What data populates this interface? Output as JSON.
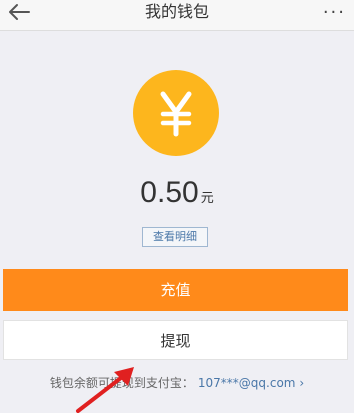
{
  "header": {
    "title": "我的钱包",
    "back_icon": "back-arrow-icon",
    "more_label": "···"
  },
  "coin": {
    "symbol": "¥",
    "color": "#fdb61d"
  },
  "balance": {
    "value": "0.50",
    "unit": "元"
  },
  "details_button": {
    "label": "查看明细"
  },
  "recharge_button": {
    "label": "充值",
    "color": "#ff8a1a"
  },
  "withdraw_button": {
    "label": "提现"
  },
  "footer": {
    "note": "钱包余额可提现到支付宝：",
    "account": "107***@qq.com",
    "chevron": "›"
  },
  "annotation": {
    "arrow_color": "#e02020"
  }
}
